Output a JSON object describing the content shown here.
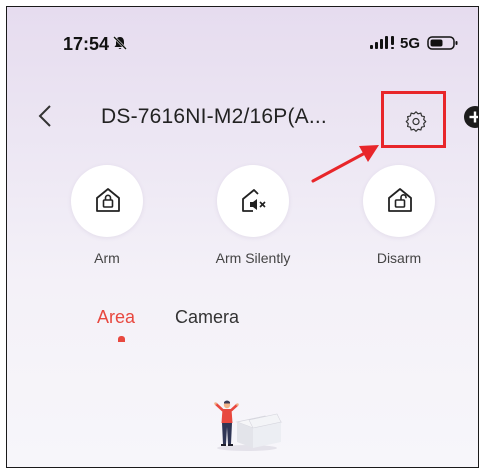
{
  "status_bar": {
    "time": "17:54",
    "network": "5G"
  },
  "header": {
    "title": "DS-7616NI-M2/16P(A..."
  },
  "actions": [
    {
      "label": "Arm"
    },
    {
      "label": "Arm Silently"
    },
    {
      "label": "Disarm"
    }
  ],
  "tabs": [
    {
      "label": "Area",
      "active": true
    },
    {
      "label": "Camera",
      "active": false
    }
  ],
  "colors": {
    "accent": "#e8483f",
    "highlight_box": "#e8262a"
  }
}
